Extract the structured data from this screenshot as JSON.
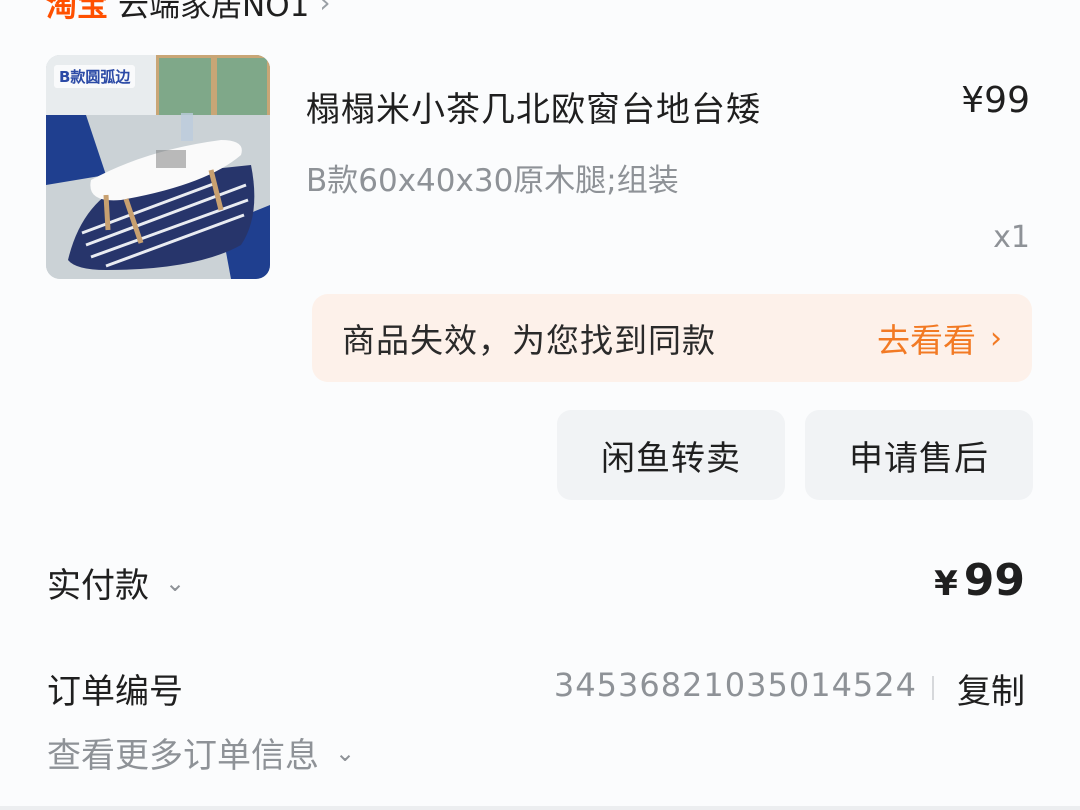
{
  "shop": {
    "brand": "淘宝",
    "name": "云端家居NO1",
    "chevron": "›"
  },
  "product": {
    "image_icon": "coffee-table-photo",
    "image_tag": "B款圆弧边",
    "title": "榻榻米小茶几北欧窗台地台矮",
    "price": "¥99",
    "spec": "B款60x40x30原木腿;组装",
    "quantity": "x1"
  },
  "invalid_notice": {
    "text": "商品失效，为您找到同款",
    "action": "去看看",
    "chevron": "›"
  },
  "actions": {
    "xianyu": "闲鱼转卖",
    "after_sale": "申请售后"
  },
  "payment": {
    "label": "实付款",
    "currency": "¥",
    "amount": "99",
    "chevron": "⌄"
  },
  "order": {
    "label": "订单编号",
    "number": "3453682103501452",
    "number_suffix": "4",
    "copy": "复制",
    "more": "查看更多订单信息",
    "more_chevron": "⌄"
  },
  "colors": {
    "brand": "#ff5000",
    "accent_orange": "#f27a24",
    "banner_bg": "#fdf1ea",
    "button_bg": "#f1f3f5",
    "muted_text": "#8e9297"
  }
}
